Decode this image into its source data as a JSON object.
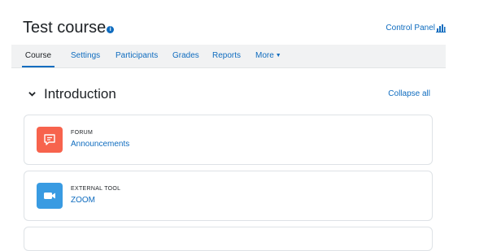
{
  "course": {
    "title": "Test course",
    "info_icon": "info-icon",
    "control_panel": "Control Panel",
    "control_panel_icon": "bar-chart-icon"
  },
  "nav": {
    "tabs": [
      {
        "label": "Course",
        "active": true
      },
      {
        "label": "Settings"
      },
      {
        "label": "Participants"
      },
      {
        "label": "Grades"
      },
      {
        "label": "Reports"
      },
      {
        "label": "More"
      }
    ]
  },
  "section": {
    "title": "Introduction",
    "collapse_label": "Collapse all"
  },
  "activities": [
    {
      "type": "FORUM",
      "name": "Announcements",
      "icon": "forum-icon",
      "color": "#f7634d"
    },
    {
      "type": "EXTERNAL TOOL",
      "name": "ZOOM",
      "icon": "video-camera-icon",
      "color": "#399be2"
    }
  ],
  "colors": {
    "link": "#0f6cbf",
    "nav_bg": "#f1f2f3"
  }
}
